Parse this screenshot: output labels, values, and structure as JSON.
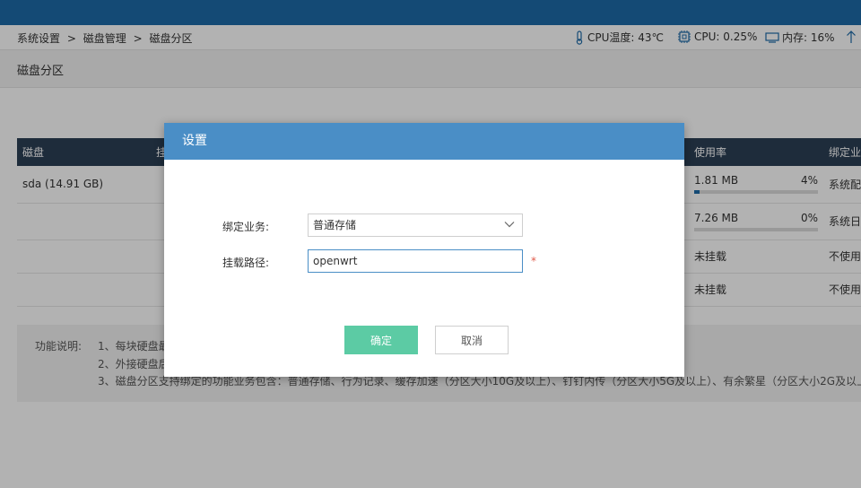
{
  "breadcrumb": [
    "系统设置",
    ">",
    "磁盘管理",
    ">",
    "磁盘分区"
  ],
  "status": {
    "cpu_temp": "CPU温度: 43℃",
    "cpu_usage": "CPU: 0.25%",
    "memory": "内存: 16%"
  },
  "page_title": "磁盘分区",
  "table": {
    "headers": [
      "磁盘",
      "挂",
      "使用率",
      "绑定业"
    ],
    "rows": [
      {
        "disk": "sda (14.91 GB)",
        "usage_text": "1.81 MB",
        "usage_pct": "4%",
        "usage_fraction": 0.04,
        "biz": "系统配"
      },
      {
        "disk": "",
        "usage_text": "7.26 MB",
        "usage_pct": "0%",
        "usage_fraction": 0.0,
        "biz": "系统日"
      },
      {
        "disk": "",
        "usage_text": "未挂载",
        "biz": "不使用"
      },
      {
        "disk": "",
        "usage_text": "未挂载",
        "biz": "不使用"
      }
    ]
  },
  "description": {
    "label": "功能说明:",
    "lines": [
      "1、每块硬盘最",
      "2、外接硬盘后",
      "3、磁盘分区支持绑定的功能业务包含：普通存储、行为记录、缓存加速（分区大小10G及以上）、钉钉内传（分区大小5G及以上）、有余繁星（分区大小2G及以上"
    ]
  },
  "dialog": {
    "title": "设置",
    "business_label": "绑定业务:",
    "business_value": "普通存储",
    "path_label": "挂载路径:",
    "path_value": "openwrt",
    "required_mark": "*",
    "ok_label": "确定",
    "cancel_label": "取消"
  },
  "colors": {
    "topbar": "#1d6aa8",
    "dialog_header": "#4a8ec6",
    "ok_button": "#5ccba4",
    "table_header": "#2c3f55",
    "biz_link": "#e08a2a"
  }
}
